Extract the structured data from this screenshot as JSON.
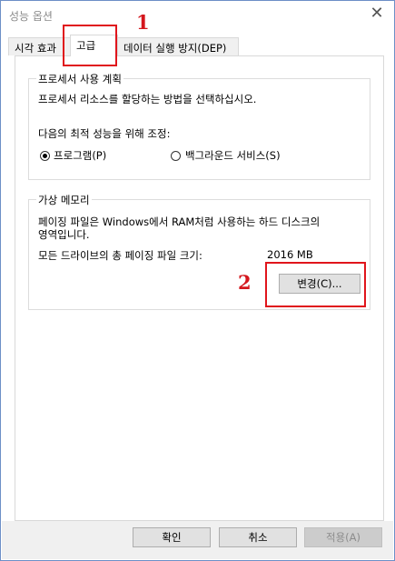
{
  "window": {
    "title": "성능 옵션",
    "close_symbol": "✕"
  },
  "tabs": [
    {
      "label": "시각 효과"
    },
    {
      "label": "고급"
    },
    {
      "label": "데이터 실행 방지(DEP)"
    }
  ],
  "processor": {
    "legend": "프로세서 사용 계획",
    "description": "프로세서 리소스를 할당하는 방법을 선택하십시오.",
    "adjust_label": "다음의 최적 성능을 위해 조정:",
    "options": [
      {
        "label": "프로그램(P)",
        "selected": true
      },
      {
        "label": "백그라운드 서비스(S)",
        "selected": false
      }
    ]
  },
  "virtual_memory": {
    "legend": "가상 메모리",
    "description_line1": "페이징 파일은 Windows에서 RAM처럼 사용하는 하드 디스크의",
    "description_line2": "영역입니다.",
    "total_label": "모든 드라이브의 총 페이징 파일 크기:",
    "total_value": "2016 MB",
    "change_button": "변경(C)..."
  },
  "buttons": {
    "ok": "확인",
    "cancel": "취소",
    "apply": "적용(A)"
  },
  "annotations": {
    "step1": "1",
    "step2": "2",
    "color": "#e0151c"
  }
}
